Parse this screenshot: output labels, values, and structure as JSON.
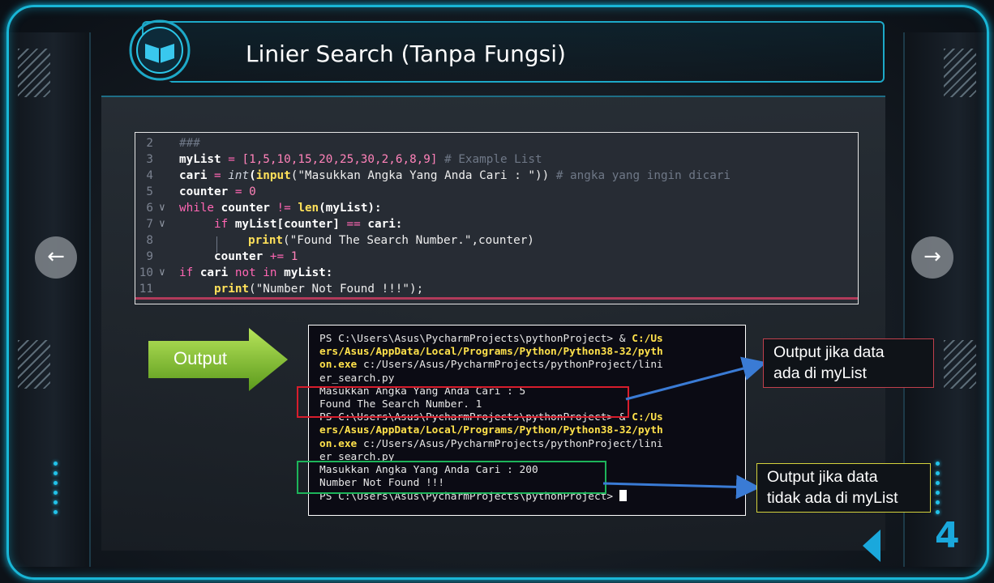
{
  "slide": {
    "title": "Linier Search (Tanpa Fungsi)",
    "page_number": "4",
    "output_label": "Output"
  },
  "code": {
    "lines": [
      {
        "n": "2"
      },
      {
        "n": "3"
      },
      {
        "n": "4"
      },
      {
        "n": "5"
      },
      {
        "n": "6"
      },
      {
        "n": "7"
      },
      {
        "n": "8"
      },
      {
        "n": "9"
      },
      {
        "n": "10"
      },
      {
        "n": "11"
      }
    ],
    "tokens": {
      "l2": "###",
      "l3_a": "myList",
      "l3_b": " = ",
      "l3_c": "[1,5,10,15,20,25,30,2,6,8,9]",
      "l3_d": " # Example List",
      "l4_a": "cari",
      "l4_b": " = ",
      "l4_c": "int",
      "l4_d": "(",
      "l4_e": "input",
      "l4_f": "(\"Masukkan Angka Yang Anda Cari : \"))",
      "l4_g": " # angka yang ingin dicari",
      "l5_a": "counter",
      "l5_b": " = ",
      "l5_c": "0",
      "l6_a": "while",
      "l6_b": " counter ",
      "l6_c": "!=",
      "l6_d": " ",
      "l6_e": "len",
      "l6_f": "(myList):",
      "l7_a": "if",
      "l7_b": " myList[counter] ",
      "l7_c": "==",
      "l7_d": " cari:",
      "l8_a": "print",
      "l8_b": "(\"Found The Search Number.\",counter)",
      "l9_a": "counter",
      "l9_b": " += ",
      "l9_c": "1",
      "l10_a": "if",
      "l10_b": " cari ",
      "l10_c": "not in",
      "l10_d": " myList:",
      "l11_a": "print",
      "l11_b": "(\"Number Not Found !!!\");"
    }
  },
  "terminal": {
    "t1_a": "PS C:\\Users\\Asus\\PycharmProjects\\pythonProject> & ",
    "t1_b": "C:/Us",
    "t2": "ers/Asus/AppData/Local/Programs/Python/Python38-32/pyth",
    "t3_a": "on.exe",
    "t3_b": " c:/Users/Asus/PycharmProjects/pythonProject/lini",
    "t4": "er_search.py",
    "t5": "Masukkan Angka Yang Anda Cari : 5",
    "t6": "Found The Search Number. 1",
    "t7_a": "PS C:\\Users\\Asus\\PycharmProjects\\pythonProject> & ",
    "t7_b": "C:/Us",
    "t8": "ers/Asus/AppData/Local/Programs/Python/Python38-32/pyth",
    "t9_a": "on.exe",
    "t9_b": " c:/Users/Asus/PycharmProjects/pythonProject/lini",
    "t10": "er_search.py",
    "t11": "Masukkan Angka Yang Anda Cari : 200",
    "t12": "Number Not Found !!!",
    "t13": "PS C:\\Users\\Asus\\PycharmProjects\\pythonProject> "
  },
  "callouts": {
    "found_line1": "Output jika data",
    "found_line2": "ada di myList",
    "notfound_line1": "Output jika data",
    "notfound_line2": "tidak ada di myList"
  },
  "navigation": {
    "prev_icon": "arrow-left-icon",
    "next_icon": "arrow-right-icon",
    "prev_glyph": "←",
    "next_glyph": "→"
  },
  "colors": {
    "accent": "#19b6d6",
    "keyword": "#ff66b3",
    "function": "#ffe15a",
    "highlight_found": "#d81d2c",
    "highlight_not_found": "#1db45a",
    "callout_found_border": "#c0404c",
    "callout_not_found_border": "#d4d23c",
    "connector": "#3a7bd5"
  }
}
